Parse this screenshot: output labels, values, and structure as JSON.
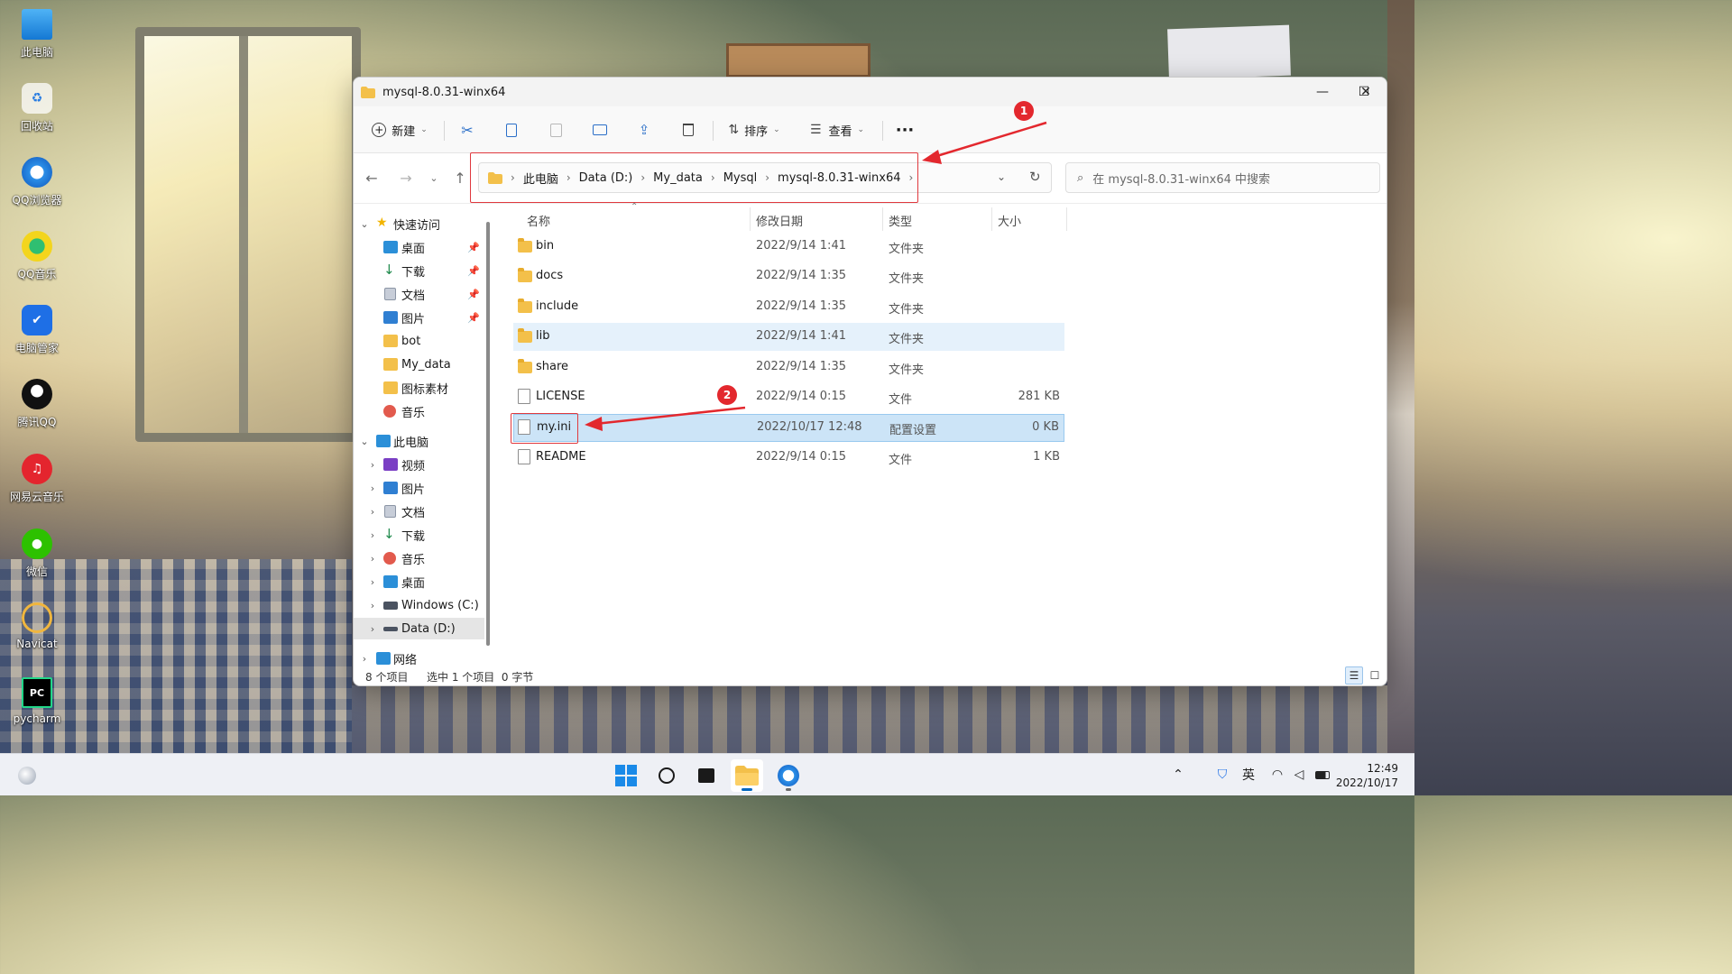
{
  "desktop_icons": [
    {
      "label": "此电脑",
      "icon": "computer-icon"
    },
    {
      "label": "回收站",
      "icon": "recycle-bin-icon"
    },
    {
      "label": "QQ浏览器",
      "icon": "qq-browser-icon"
    },
    {
      "label": "QQ音乐",
      "icon": "qq-music-icon"
    },
    {
      "label": "电脑管家",
      "icon": "pc-manager-icon"
    },
    {
      "label": "腾讯QQ",
      "icon": "qq-icon"
    },
    {
      "label": "网易云音乐",
      "icon": "netease-music-icon"
    },
    {
      "label": "微信",
      "icon": "wechat-icon"
    },
    {
      "label": "Navicat",
      "icon": "navicat-icon"
    },
    {
      "label": "pycharm",
      "icon": "pycharm-icon"
    }
  ],
  "window": {
    "title": "mysql-8.0.31-winx64",
    "minimize": "—",
    "maximize": "☐",
    "close": "✕"
  },
  "toolbar": {
    "new_label": "新建",
    "sort_label": "排序",
    "view_label": "查看",
    "more_label": "···"
  },
  "address": {
    "crumbs": [
      "此电脑",
      "Data (D:)",
      "My_data",
      "Mysql",
      "mysql-8.0.31-winx64"
    ],
    "search_placeholder": "在 mysql-8.0.31-winx64 中搜索"
  },
  "sidebar": {
    "quick_access": "快速访问",
    "quick_items": [
      "桌面",
      "下载",
      "文档",
      "图片",
      "bot",
      "My_data",
      "图标素材",
      "音乐"
    ],
    "this_pc": "此电脑",
    "pc_items": [
      "视频",
      "图片",
      "文档",
      "下载",
      "音乐",
      "桌面",
      "Windows (C:)",
      "Data (D:)"
    ],
    "network": "网络"
  },
  "columns": {
    "name": "名称",
    "date": "修改日期",
    "type": "类型",
    "size": "大小"
  },
  "files": [
    {
      "name": "bin",
      "date": "2022/9/14 1:41",
      "type": "文件夹",
      "size": "",
      "kind": "folder"
    },
    {
      "name": "docs",
      "date": "2022/9/14 1:35",
      "type": "文件夹",
      "size": "",
      "kind": "folder"
    },
    {
      "name": "include",
      "date": "2022/9/14 1:35",
      "type": "文件夹",
      "size": "",
      "kind": "folder"
    },
    {
      "name": "lib",
      "date": "2022/9/14 1:41",
      "type": "文件夹",
      "size": "",
      "kind": "folder"
    },
    {
      "name": "share",
      "date": "2022/9/14 1:35",
      "type": "文件夹",
      "size": "",
      "kind": "folder"
    },
    {
      "name": "LICENSE",
      "date": "2022/9/14 0:15",
      "type": "文件",
      "size": "281 KB",
      "kind": "file"
    },
    {
      "name": "my.ini",
      "date": "2022/10/17 12:48",
      "type": "配置设置",
      "size": "0 KB",
      "kind": "file"
    },
    {
      "name": "README",
      "date": "2022/9/14 0:15",
      "type": "文件",
      "size": "1 KB",
      "kind": "file"
    }
  ],
  "status": {
    "count": "8 个项目",
    "selection": "选中 1 个项目  0 字节"
  },
  "annotations": {
    "badge1": "1",
    "badge2": "2"
  },
  "taskbar": {
    "ime": "英",
    "time": "12:49",
    "date": "2022/10/17"
  },
  "colors": {
    "accent": "#0067c0",
    "annotation": "#e3282e",
    "folder": "#f3c04a",
    "selected_row": "#cce4f7"
  }
}
